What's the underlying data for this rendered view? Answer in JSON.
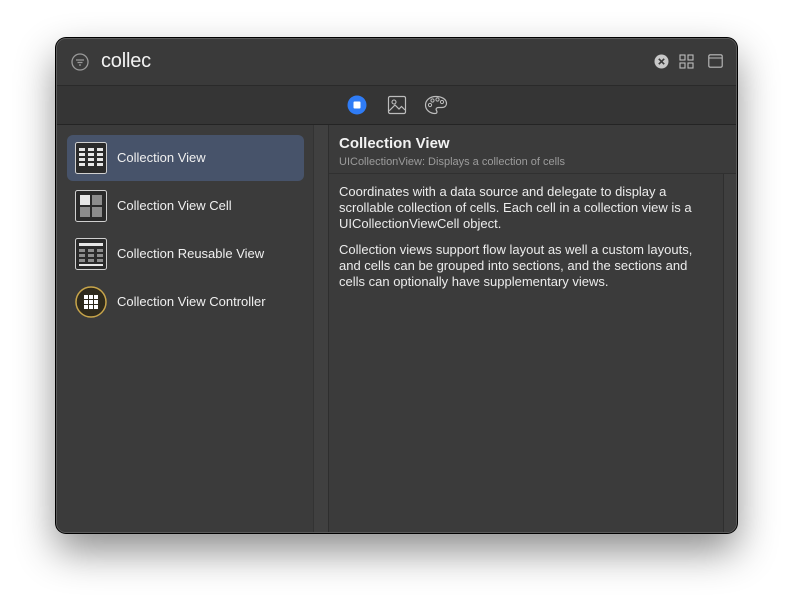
{
  "search": {
    "value": "collec",
    "filter_icon": "filter-icon",
    "clear_icon": "clear-icon",
    "grid_icon": "grid-view-icon",
    "panel_icon": "panel-icon"
  },
  "tabs": [
    {
      "name": "objects",
      "icon": "objects-icon",
      "selected": true
    },
    {
      "name": "media",
      "icon": "image-icon",
      "selected": false
    },
    {
      "name": "colors",
      "icon": "palette-icon",
      "selected": false
    }
  ],
  "library_items": [
    {
      "label": "Collection View",
      "icon": "collection-view-icon",
      "selected": true
    },
    {
      "label": "Collection View Cell",
      "icon": "collection-view-cell-icon",
      "selected": false
    },
    {
      "label": "Collection Reusable View",
      "icon": "collection-reusable-view-icon",
      "selected": false
    },
    {
      "label": "Collection View Controller",
      "icon": "collection-view-controller-icon",
      "selected": false
    }
  ],
  "detail": {
    "title": "Collection View",
    "subtitle": "UICollectionView: Displays a collection of cells",
    "paragraphs": [
      "Coordinates with a data source and delegate to display a scrollable collection of cells. Each cell in a collection view is a UICollectionViewCell object.",
      "Collection views support flow layout as well a custom layouts, and cells can be grouped into sections, and the sections and cells can optionally have supplementary views."
    ]
  },
  "colors": {
    "accent": "#2f7cf6",
    "selection": "#47536a",
    "controller_gold": "#c8a54a"
  }
}
